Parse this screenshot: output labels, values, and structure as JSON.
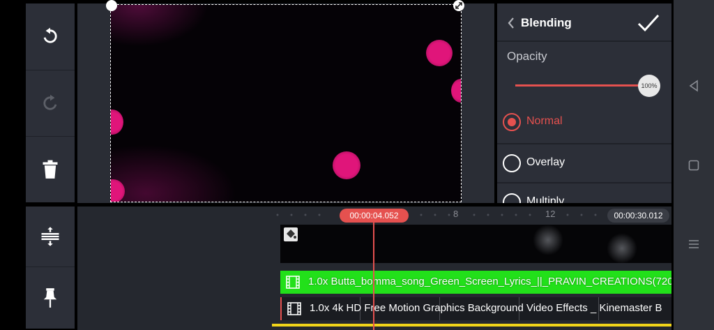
{
  "left_tools": {
    "undo": "undo-icon",
    "redo": "redo-icon",
    "delete": "trash-icon",
    "split": "split-align-icon",
    "pin": "pin-icon"
  },
  "panel": {
    "title": "Blending",
    "opacity_label": "Opacity",
    "opacity_value": "100%",
    "opacity_fraction": 1.0,
    "options": [
      {
        "label": "Normal",
        "selected": true
      },
      {
        "label": "Overlay",
        "selected": false
      },
      {
        "label": "Multiply",
        "selected": false
      }
    ]
  },
  "timeline": {
    "current_time": "00:00:04.052",
    "total_time": "00:00:30.012",
    "ruler_labels": [
      "8",
      "12"
    ],
    "clips": [
      {
        "label": "1.0x Butta_bomma_song_Green_Screen_Lyrics_||_PRAVIN_CREATIONS(720"
      },
      {
        "label": "1.0x 4k HD Free Motion Graphics Background Video Effects _ Kinemaster B"
      }
    ]
  },
  "colors": {
    "accent": "#e5514f",
    "green_clip": "#22e01a",
    "panel_bg": "#2c2f38",
    "dot_pink": "#e0157a"
  }
}
